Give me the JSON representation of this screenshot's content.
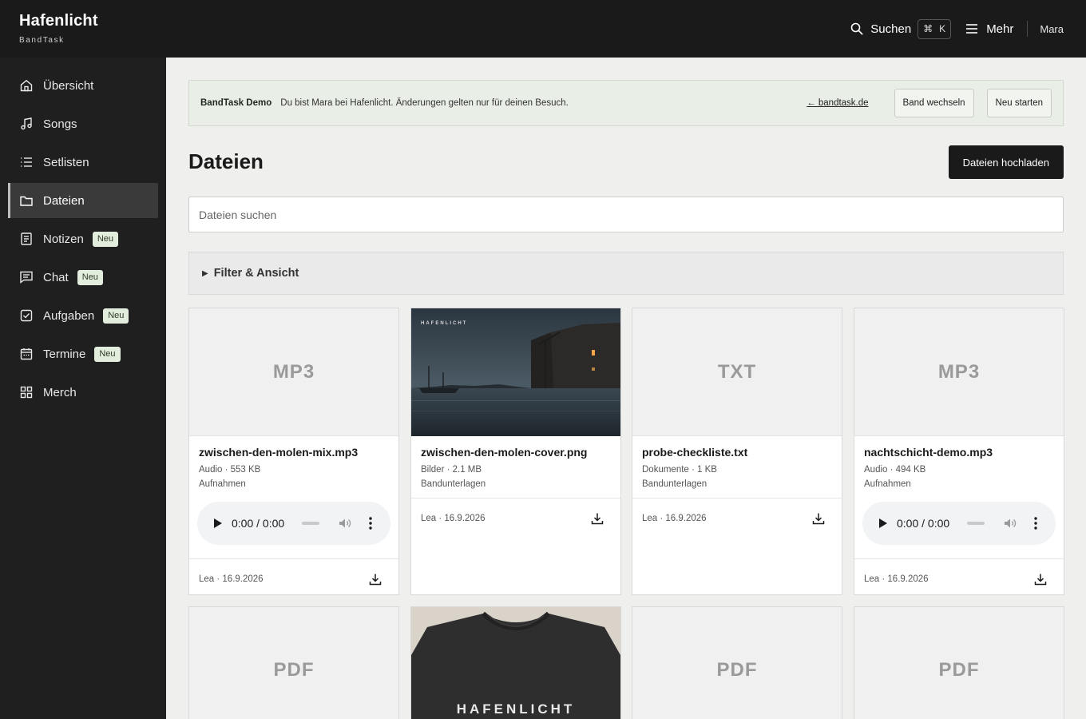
{
  "app": {
    "name": "Hafenlicht",
    "subtitle": "BandTask"
  },
  "topbar": {
    "search_label": "Suchen",
    "shortcut_mod": "⌘",
    "shortcut_key": "K",
    "more_label": "Mehr",
    "user": "Mara"
  },
  "sidebar": {
    "items": [
      {
        "label": "Übersicht",
        "icon": "home-icon"
      },
      {
        "label": "Songs",
        "icon": "music-note-icon"
      },
      {
        "label": "Setlisten",
        "icon": "list-icon"
      },
      {
        "label": "Dateien",
        "icon": "folder-icon",
        "active": true
      },
      {
        "label": "Notizen",
        "icon": "note-icon",
        "badge": "Neu"
      },
      {
        "label": "Chat",
        "icon": "chat-icon",
        "badge": "Neu"
      },
      {
        "label": "Aufgaben",
        "icon": "checkbox-icon",
        "badge": "Neu"
      },
      {
        "label": "Termine",
        "icon": "calendar-icon",
        "badge": "Neu"
      },
      {
        "label": "Merch",
        "icon": "grid-icon"
      }
    ]
  },
  "demo": {
    "title": "BandTask Demo",
    "text": "Du bist Mara bei Hafenlicht. Änderungen gelten nur für deinen Besuch.",
    "link": "← bandtask.de",
    "switch_band": "Band wechseln",
    "restart": "Neu starten"
  },
  "page": {
    "title": "Dateien",
    "upload_label": "Dateien hochladen",
    "search_placeholder": "Dateien suchen",
    "filter_label": "Filter & Ansicht"
  },
  "files": [
    {
      "thumb": "MP3",
      "name": "zwischen-den-molen-mix.mp3",
      "meta": "Audio · 553 KB",
      "category": "Aufnahmen",
      "time": "0:00 / 0:00",
      "uploader": "Lea · 16.9.2026"
    },
    {
      "thumb": "",
      "thumb_text": "HAFENLICHT",
      "name": "zwischen-den-molen-cover.png",
      "meta": "Bilder · 2.1 MB",
      "category": "Bandunterlagen",
      "uploader": "Lea · 16.9.2026"
    },
    {
      "thumb": "TXT",
      "name": "probe-checkliste.txt",
      "meta": "Dokumente · 1 KB",
      "category": "Bandunterlagen",
      "uploader": "Lea · 16.9.2026"
    },
    {
      "thumb": "MP3",
      "name": "nachtschicht-demo.mp3",
      "meta": "Audio · 494 KB",
      "category": "Aufnahmen",
      "time": "0:00 / 0:00",
      "uploader": "Lea · 16.9.2026"
    },
    {
      "thumb": "PDF"
    },
    {
      "thumb": "",
      "thumb_text": "HAFENLICHT"
    },
    {
      "thumb": "PDF"
    },
    {
      "thumb": "PDF"
    }
  ],
  "colors": {
    "topbar": "#1a1a1a",
    "sidebar": "#1f1f1f",
    "badge_bg": "#e3eddd",
    "banner_bg": "#e9eee6"
  }
}
